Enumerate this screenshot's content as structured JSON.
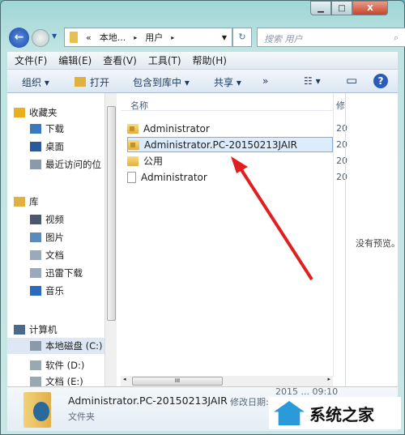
{
  "window": {
    "minimize": "▁",
    "maximize": "□",
    "close": "X"
  },
  "nav": {
    "breadcrumb": [
      "«",
      "本地...",
      "▸",
      "用户",
      "▸"
    ],
    "search_placeholder": "搜索 用户",
    "search_icon": "⌕",
    "refresh": "↻"
  },
  "menu": [
    "文件(F)",
    "编辑(E)",
    "查看(V)",
    "工具(T)",
    "帮助(H)"
  ],
  "toolbar": {
    "organize": "组织 ▾",
    "open": "打开",
    "include": "包含到库中 ▾",
    "share": "共享 ▾",
    "more": "»",
    "views": "☷ ▾",
    "pane": "▭",
    "help": "?"
  },
  "sidebar": [
    {
      "label": "收藏夹",
      "icon": "star-icon",
      "color": "#e8b020"
    },
    {
      "label": "下载",
      "icon": "download-folder-icon",
      "color": "#3a78c0"
    },
    {
      "label": "桌面",
      "icon": "desktop-icon",
      "color": "#2a5a9a"
    },
    {
      "label": "最近访问的位",
      "icon": "recent-places-icon",
      "color": "#8a9aa8"
    },
    {
      "label": "库",
      "icon": "library-icon",
      "color": "#e0b040"
    },
    {
      "label": "视频",
      "icon": "video-icon",
      "color": "#4a5a6a"
    },
    {
      "label": "图片",
      "icon": "pictures-icon",
      "color": "#5a8aba"
    },
    {
      "label": "文档",
      "icon": "documents-icon",
      "color": "#9aaab8"
    },
    {
      "label": "迅雷下载",
      "icon": "thunder-download-icon",
      "color": "#9aaab8"
    },
    {
      "label": "音乐",
      "icon": "music-icon",
      "color": "#2a6ac0"
    },
    {
      "label": "计算机",
      "icon": "computer-icon",
      "color": "#4a6a8a"
    },
    {
      "label": "本地磁盘 (C:)",
      "icon": "drive-icon",
      "color": "#8a9aa8"
    },
    {
      "label": "软件 (D:)",
      "icon": "drive-icon",
      "color": "#9aa8b0"
    },
    {
      "label": "文档 (E:)",
      "icon": "drive-icon",
      "color": "#9aa8b0"
    }
  ],
  "columns": {
    "name": "名称",
    "modified": "修"
  },
  "files": [
    {
      "name": "Administrator",
      "type": "locked-folder",
      "date": "20"
    },
    {
      "name": "Administrator.PC-20150213JAIR",
      "type": "locked-folder",
      "date": "20",
      "selected": true
    },
    {
      "name": "公用",
      "type": "folder",
      "date": "20"
    },
    {
      "name": "Administrator",
      "type": "file",
      "date": "20"
    }
  ],
  "preview": "没有预览。",
  "details": {
    "name": "Administrator.PC-20150213JAIR",
    "date_label": "修改日期:",
    "date_value": "2015 ... 09:10",
    "type": "文件夹"
  },
  "watermark": "系统之家",
  "accent": "#e02020"
}
